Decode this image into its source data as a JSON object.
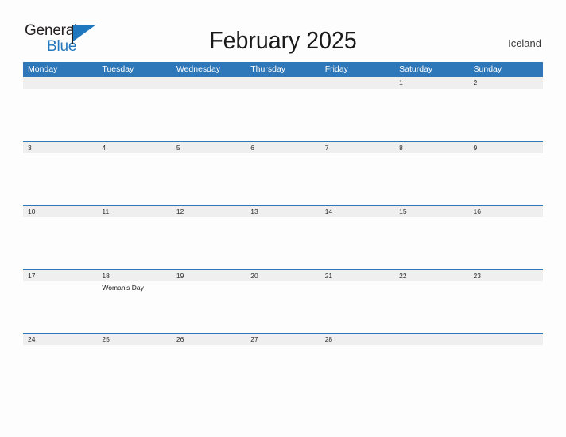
{
  "brand": {
    "word_one": "General",
    "word_two": "Blue",
    "mark": "flag-triangle",
    "color_dark": "#231f20",
    "color_blue": "#2478bd"
  },
  "header": {
    "title": "February 2025",
    "country": "Iceland"
  },
  "colors": {
    "header_blue": "#2e78ba",
    "date_band_gray": "#efefef",
    "page_background": "#fdfdfd",
    "text_dark": "#1a1a1a"
  },
  "calendar": {
    "weekdays": [
      "Monday",
      "Tuesday",
      "Wednesday",
      "Thursday",
      "Friday",
      "Saturday",
      "Sunday"
    ],
    "weeks": [
      {
        "days": [
          {
            "date": "",
            "event": ""
          },
          {
            "date": "",
            "event": ""
          },
          {
            "date": "",
            "event": ""
          },
          {
            "date": "",
            "event": ""
          },
          {
            "date": "",
            "event": ""
          },
          {
            "date": "1",
            "event": ""
          },
          {
            "date": "2",
            "event": ""
          }
        ]
      },
      {
        "days": [
          {
            "date": "3",
            "event": ""
          },
          {
            "date": "4",
            "event": ""
          },
          {
            "date": "5",
            "event": ""
          },
          {
            "date": "6",
            "event": ""
          },
          {
            "date": "7",
            "event": ""
          },
          {
            "date": "8",
            "event": ""
          },
          {
            "date": "9",
            "event": ""
          }
        ]
      },
      {
        "days": [
          {
            "date": "10",
            "event": ""
          },
          {
            "date": "11",
            "event": ""
          },
          {
            "date": "12",
            "event": ""
          },
          {
            "date": "13",
            "event": ""
          },
          {
            "date": "14",
            "event": ""
          },
          {
            "date": "15",
            "event": ""
          },
          {
            "date": "16",
            "event": ""
          }
        ]
      },
      {
        "days": [
          {
            "date": "17",
            "event": ""
          },
          {
            "date": "18",
            "event": "Woman's Day"
          },
          {
            "date": "19",
            "event": ""
          },
          {
            "date": "20",
            "event": ""
          },
          {
            "date": "21",
            "event": ""
          },
          {
            "date": "22",
            "event": ""
          },
          {
            "date": "23",
            "event": ""
          }
        ]
      },
      {
        "days": [
          {
            "date": "24",
            "event": ""
          },
          {
            "date": "25",
            "event": ""
          },
          {
            "date": "26",
            "event": ""
          },
          {
            "date": "27",
            "event": ""
          },
          {
            "date": "28",
            "event": ""
          },
          {
            "date": "",
            "event": ""
          },
          {
            "date": "",
            "event": ""
          }
        ]
      }
    ]
  }
}
